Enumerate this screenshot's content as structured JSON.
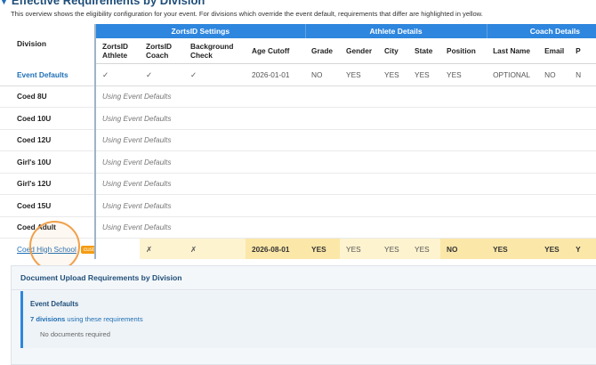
{
  "section": {
    "title": "Effective Requirements by Division",
    "intro": "This overview shows the eligibility configuration for your event. For divisions which override the event default, requirements that differ are highlighted in yellow."
  },
  "table": {
    "division_header": "Division",
    "groups": {
      "zortsid": "ZortsID Settings",
      "athlete": "Athlete Details",
      "coach": "Coach Details"
    },
    "columns": {
      "zortsid_athlete": "ZortsID Athlete",
      "zortsid_coach": "ZortsID Coach",
      "background_check": "Background Check",
      "age_cutoff": "Age Cutoff",
      "grade": "Grade",
      "gender": "Gender",
      "city": "City",
      "state": "State",
      "position": "Position",
      "last_name": "Last Name",
      "email": "Email",
      "phone": "P"
    },
    "defaults_row": {
      "label": "Event Defaults",
      "zortsid_athlete": "✓",
      "zortsid_coach": "✓",
      "background_check": "✓",
      "age_cutoff": "2026-01-01",
      "grade": "NO",
      "gender": "YES",
      "city": "YES",
      "state": "YES",
      "position": "YES",
      "last_name": "OPTIONAL",
      "email": "NO",
      "phone": "N"
    },
    "default_rows": [
      {
        "name": "Coed 8U",
        "status": "Using Event Defaults"
      },
      {
        "name": "Coed 10U",
        "status": "Using Event Defaults"
      },
      {
        "name": "Coed 12U",
        "status": "Using Event Defaults"
      },
      {
        "name": "Girl's 10U",
        "status": "Using Event Defaults"
      },
      {
        "name": "Girl's 12U",
        "status": "Using Event Defaults"
      },
      {
        "name": "Coed 15U",
        "status": "Using Event Defaults"
      },
      {
        "name": "Coed Adult",
        "status": "Using Event Defaults"
      }
    ],
    "custom_row": {
      "name": "Coed High School",
      "badge": "custom",
      "zortsid_athlete": "",
      "zortsid_coach": "✗",
      "background_check": "✗",
      "age_cutoff": "2026-08-01",
      "grade": "YES",
      "gender": "YES",
      "city": "YES",
      "state": "YES",
      "position": "NO",
      "last_name": "YES",
      "email": "YES",
      "phone": "Y"
    }
  },
  "documents": {
    "title": "Document Upload Requirements by Division",
    "card_title": "Event Defaults",
    "count_value": "7 divisions",
    "count_suffix": " using these requirements",
    "empty_text": "No documents required"
  },
  "colors": {
    "header_blue": "#2e86de",
    "highlight_yellow": "#fdf3cf",
    "badge_orange": "#f39c12",
    "link_blue": "#1f6fb5"
  }
}
